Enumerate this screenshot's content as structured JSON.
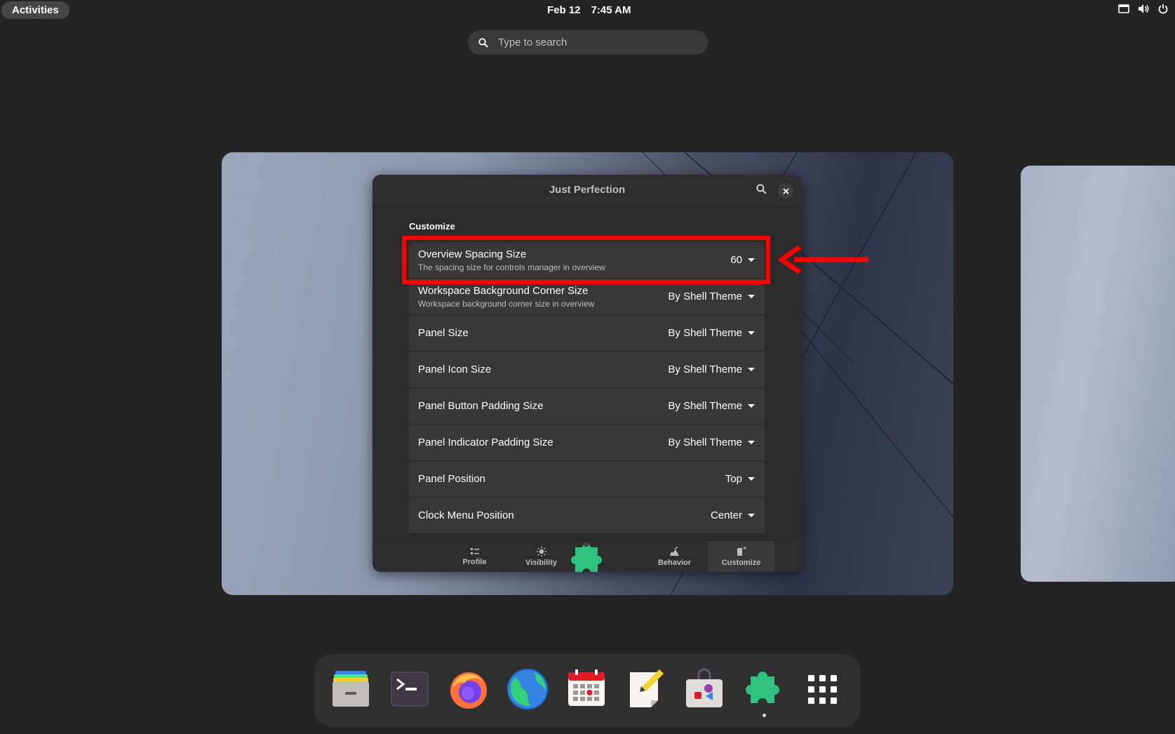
{
  "topbar": {
    "activities": "Activities",
    "date": "Feb 12",
    "time": "7:45 AM"
  },
  "search": {
    "placeholder": "Type to search"
  },
  "window": {
    "title": "Just Perfection",
    "section": "Customize",
    "rows": [
      {
        "label": "Overview Spacing Size",
        "sub": "The spacing size for controls manager in overview",
        "value": "60"
      },
      {
        "label": "Workspace Background Corner Size",
        "sub": "Workspace background corner size in overview",
        "value": "By Shell Theme"
      },
      {
        "label": "Panel Size",
        "sub": "",
        "value": "By Shell Theme"
      },
      {
        "label": "Panel Icon Size",
        "sub": "",
        "value": "By Shell Theme"
      },
      {
        "label": "Panel Button Padding Size",
        "sub": "",
        "value": "By Shell Theme"
      },
      {
        "label": "Panel Indicator Padding Size",
        "sub": "",
        "value": "By Shell Theme"
      },
      {
        "label": "Panel Position",
        "sub": "",
        "value": "Top"
      },
      {
        "label": "Clock Menu Position",
        "sub": "",
        "value": "Center"
      }
    ],
    "tabs": {
      "profile": "Profile",
      "visibility": "Visibility",
      "behavior": "Behavior",
      "customize": "Customize"
    }
  },
  "dock": {
    "items": [
      "files-icon",
      "terminal-icon",
      "firefox-icon",
      "web-browser-icon",
      "calendar-icon",
      "text-editor-icon",
      "software-icon",
      "extensions-icon",
      "app-grid-icon"
    ]
  },
  "colors": {
    "highlight": "#ff0000",
    "accent_green": "#2ec27e"
  }
}
